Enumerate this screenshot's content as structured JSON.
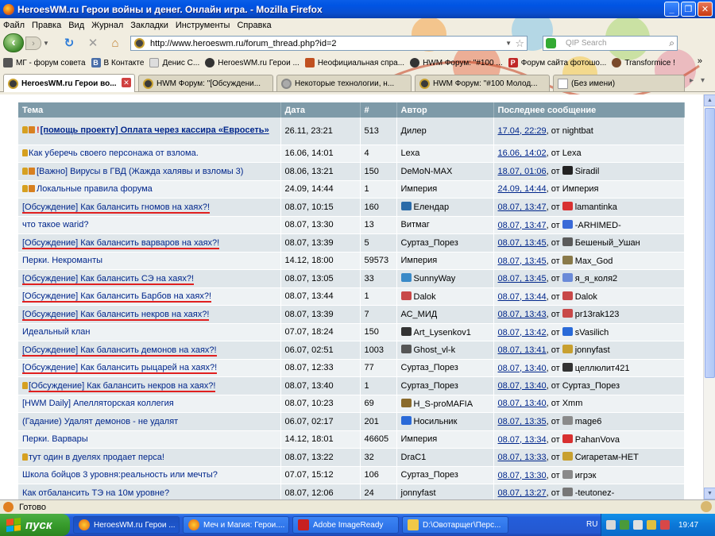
{
  "window": {
    "title": "HeroesWM.ru Герои войны и денег. Онлайн игра. - Mozilla Firefox"
  },
  "menu": [
    "Файл",
    "Правка",
    "Вид",
    "Журнал",
    "Закладки",
    "Инструменты",
    "Справка"
  ],
  "nav": {
    "url": "http://www.heroeswm.ru/forum_thread.php?id=2",
    "search_placeholder": "QIP Search"
  },
  "bookmarks": [
    {
      "label": "МГ - форум совета",
      "icon": "bookmark-icon"
    },
    {
      "label": "В Контакте",
      "icon": "vk-icon"
    },
    {
      "label": "Денис С...",
      "icon": "page-icon"
    },
    {
      "label": "HeroesWM.ru Герои ...",
      "icon": "hwm-icon"
    },
    {
      "label": "Неофициальная спра...",
      "icon": "book-icon"
    },
    {
      "label": "HWM Форум: \"#100 ...",
      "icon": "hwm-icon"
    },
    {
      "label": "Форум сайта фотошо...",
      "icon": "ps-icon"
    },
    {
      "label": "Transformice !",
      "icon": "mouse-icon"
    }
  ],
  "bookmarks_more": "»",
  "tabs": [
    {
      "label": "HeroesWM.ru Герои во...",
      "active": true
    },
    {
      "label": "HWM Форум: \"[Обсуждени...",
      "active": false
    },
    {
      "label": "Некоторые технологии, н...",
      "active": false
    },
    {
      "label": "HWM Форум: \"#100 Молод...",
      "active": false
    },
    {
      "label": "(Без имени)",
      "active": false
    }
  ],
  "table": {
    "headers": [
      "Тема",
      "Дата",
      "#",
      "Автор",
      "Последнее сообщение"
    ],
    "rows": [
      {
        "topic": "[помощь проекту] Оплата через кассира «Евросеть»",
        "date": "26.11, 23:21",
        "count": "513",
        "author": "Дилер",
        "last_date": "17.04, 22:29",
        "last_by": "nightbat"
      },
      {
        "topic": "Как уберечь своего персонажа от взлома.",
        "date": "16.06, 14:01",
        "count": "4",
        "author": "Lexa",
        "last_date": "16.06, 14:02",
        "last_by": "Lexa"
      },
      {
        "topic": "[Важно] Вирусы в ГВД (Жажда халявы и взломы 3)",
        "date": "08.06, 13:21",
        "count": "150",
        "author": "DeMoN-MAX",
        "last_date": "18.07, 01:06",
        "last_by": "Siradil"
      },
      {
        "topic": "Локальные правила форума",
        "date": "24.09, 14:44",
        "count": "1",
        "author": "Империя",
        "last_date": "24.09, 14:44",
        "last_by": "Империя"
      },
      {
        "topic": "[Обсуждение] Как балансить гномов на хаях?!",
        "date": "08.07, 10:15",
        "count": "160",
        "author": "Елендар",
        "last_date": "08.07, 13:47",
        "last_by": "lamantinka"
      },
      {
        "topic": "что такое warid?",
        "date": "08.07, 13:30",
        "count": "13",
        "author": "Витмаг",
        "last_date": "08.07, 13:47",
        "last_by": "-ARHIMED-"
      },
      {
        "topic": "[Обсуждение] Как балансить варваров на хаях?!",
        "date": "08.07, 13:39",
        "count": "5",
        "author": "Суртаз_Порез",
        "last_date": "08.07, 13:45",
        "last_by": "Бешеный_Ушан"
      },
      {
        "topic": "Перки. Некроманты",
        "date": "14.12, 18:00",
        "count": "59573",
        "author": "Империя",
        "last_date": "08.07, 13:45",
        "last_by": "Max_God"
      },
      {
        "topic": "[Обсуждение] Как балансить СЭ на хаях?!",
        "date": "08.07, 13:05",
        "count": "33",
        "author": "SunnyWay",
        "last_date": "08.07, 13:45",
        "last_by": "я_я_коля2"
      },
      {
        "topic": "[Обсуждение] Как балансить Барбов на хаях?!",
        "date": "08.07, 13:44",
        "count": "1",
        "author": "Dalok",
        "last_date": "08.07, 13:44",
        "last_by": "Dalok"
      },
      {
        "topic": "[Обсуждение] Как балансить некров на хаях?!",
        "date": "08.07, 13:39",
        "count": "7",
        "author": "АС_МИД",
        "last_date": "08.07, 13:43",
        "last_by": "pr13rak123"
      },
      {
        "topic": "Идеальный клан",
        "date": "07.07, 18:24",
        "count": "150",
        "author": "Art_Lysenkov1",
        "last_date": "08.07, 13:42",
        "last_by": "sVasilich"
      },
      {
        "topic": "[Обсуждение] Как балансить демонов на хаях?!",
        "date": "06.07, 02:51",
        "count": "1003",
        "author": "Ghost_vl-k",
        "last_date": "08.07, 13:41",
        "last_by": "jonnyfast"
      },
      {
        "topic": "[Обсуждение] Как балансить рыцарей на хаях?!",
        "date": "08.07, 12:33",
        "count": "77",
        "author": "Суртаз_Порез",
        "last_date": "08.07, 13:40",
        "last_by": "целлюлит421"
      },
      {
        "topic": "[Обсуждение] Как балансить некров на хаях?!",
        "date": "08.07, 13:40",
        "count": "1",
        "author": "Суртаз_Порез",
        "last_date": "08.07, 13:40",
        "last_by": "Суртаз_Порез"
      },
      {
        "topic": "[HWM Daily] Апелляторская коллегия",
        "date": "08.07, 10:23",
        "count": "69",
        "author": "H_S-proMAFIA",
        "last_date": "08.07, 13:40",
        "last_by": "Xmm"
      },
      {
        "topic": "(Гадание) Удалят демонов - не удалят",
        "date": "06.07, 02:17",
        "count": "201",
        "author": "Носильник",
        "last_date": "08.07, 13:35",
        "last_by": "mage6"
      },
      {
        "topic": "Перки. Варвары",
        "date": "14.12, 18:01",
        "count": "46605",
        "author": "Империя",
        "last_date": "08.07, 13:34",
        "last_by": "PahanVova"
      },
      {
        "topic": "тут один в дуелях продает перса!",
        "date": "08.07, 13:22",
        "count": "32",
        "author": "DraC1",
        "last_date": "08.07, 13:33",
        "last_by": "Сигаретам-НЕТ"
      },
      {
        "topic": "Школа бойцов 3 уровня:реальность или мечты?",
        "date": "07.07, 15:12",
        "count": "106",
        "author": "Суртаз_Порез",
        "last_date": "08.07, 13:30",
        "last_by": "игрэк"
      },
      {
        "topic": "Как отбалансить ТЭ на 10м уровне?",
        "date": "08.07, 12:06",
        "count": "24",
        "author": "jonnyfast",
        "last_date": "08.07, 13:27",
        "last_by": "-teutonez-"
      }
    ],
    "last_sep": ", от"
  },
  "status": {
    "text": "Готово"
  },
  "taskbar": {
    "start": "пуск",
    "buttons": [
      {
        "label": "HeroesWM.ru Герои ...",
        "active": true
      },
      {
        "label": "Меч и Магия: Герои....",
        "active": false
      },
      {
        "label": "Adobe ImageReady",
        "active": false
      },
      {
        "label": "D:\\Овотарщег\\Перс...",
        "active": false
      }
    ],
    "lang": "RU",
    "time": "19:47"
  },
  "colors": {
    "accent": "#0054e3",
    "table_header": "#7e9aa8",
    "link": "#00268b",
    "underline_mark": "#e02020"
  }
}
